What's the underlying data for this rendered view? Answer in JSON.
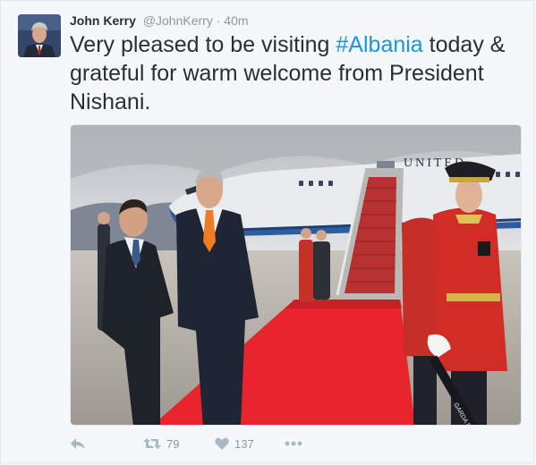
{
  "author": {
    "name": "John Kerry",
    "handle": "@JohnKerry",
    "separator": "·",
    "time": "40m"
  },
  "tweet": {
    "text_before": "Very pleased to be visiting ",
    "hashtag": "#Albania",
    "text_after": " today & grateful for warm welcome from President Nishani."
  },
  "photo": {
    "plane_text": "UNITED",
    "sash_text": "GARDA E"
  },
  "actions": {
    "reply_icon": "reply-icon",
    "retweet_icon": "retweet-icon",
    "like_icon": "heart-icon",
    "more_icon": "more-icon",
    "retweets": "79",
    "likes": "137"
  },
  "colors": {
    "hashtag": "#1b95e0",
    "text": "#292f33",
    "muted": "#8899a6",
    "action_icon": "#aab8c2",
    "background": "#f5f8fa"
  }
}
